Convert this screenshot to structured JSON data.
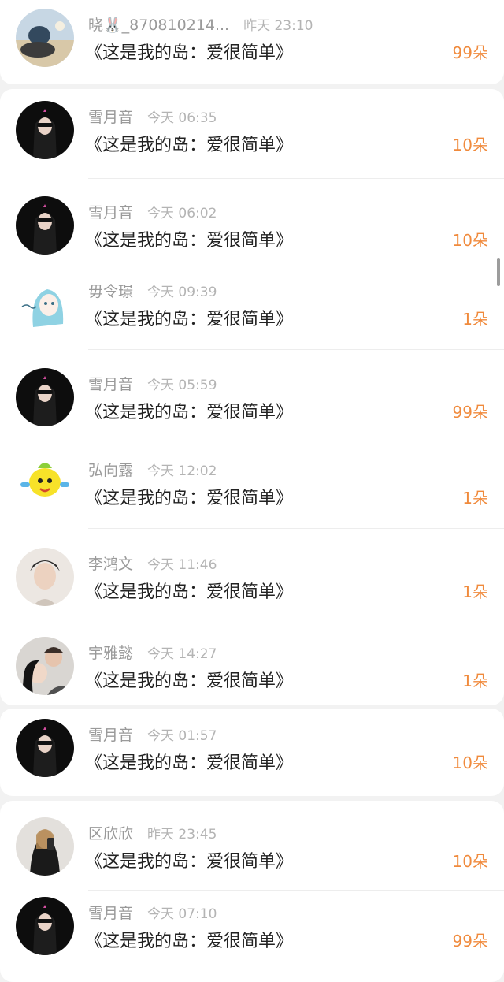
{
  "gift_list": [
    {
      "name": "晓🐰_870810214...",
      "time": "昨天 23:10",
      "title": "《这是我的岛：爱很简单》",
      "count": "99朵",
      "avatar": "beach-photo-avatar"
    },
    {
      "name": "雪月音",
      "time": "今天 06:35",
      "title": "《这是我的岛：爱很简单》",
      "count": "10朵",
      "avatar": "dark-hair-girl-avatar"
    },
    {
      "name": "雪月音",
      "time": "今天 06:02",
      "title": "《这是我的岛：爱很简单》",
      "count": "10朵",
      "avatar": "dark-hair-girl-avatar"
    },
    {
      "name": "毋令璟",
      "time": "今天 09:39",
      "title": "《这是我的岛：爱很简单》",
      "count": "1朵",
      "avatar": "anime-girl-avatar"
    },
    {
      "name": "雪月音",
      "time": "今天 05:59",
      "title": "《这是我的岛：爱很简单》",
      "count": "99朵",
      "avatar": "dark-hair-girl-avatar"
    },
    {
      "name": "弘向露",
      "time": "今天 12:02",
      "title": "《这是我的岛：爱很简单》",
      "count": "1朵",
      "avatar": "yellow-cartoon-avatar"
    },
    {
      "name": "李鸿文",
      "time": "今天 11:46",
      "title": "《这是我的岛：爱很简单》",
      "count": "1朵",
      "avatar": "man-portrait-avatar"
    },
    {
      "name": "宇雅懿",
      "time": "今天 14:27",
      "title": "《这是我的岛：爱很简单》",
      "count": "1朵",
      "avatar": "couple-photo-avatar"
    },
    {
      "name": "雪月音",
      "time": "今天 01:57",
      "title": "《这是我的岛：爱很简单》",
      "count": "10朵",
      "avatar": "dark-hair-girl-avatar"
    },
    {
      "name": "区欣欣",
      "time": "昨天 23:45",
      "title": "《这是我的岛：爱很简单》",
      "count": "10朵",
      "avatar": "mirror-selfie-avatar"
    },
    {
      "name": "雪月音",
      "time": "今天 07:10",
      "title": "《这是我的岛：爱很简单》",
      "count": "99朵",
      "avatar": "dark-hair-girl-avatar"
    }
  ],
  "colors": {
    "background": "#f2f2f2",
    "card": "#ffffff",
    "name": "#9a9a9a",
    "title": "#222222",
    "count_accent": "#f08a3c"
  }
}
